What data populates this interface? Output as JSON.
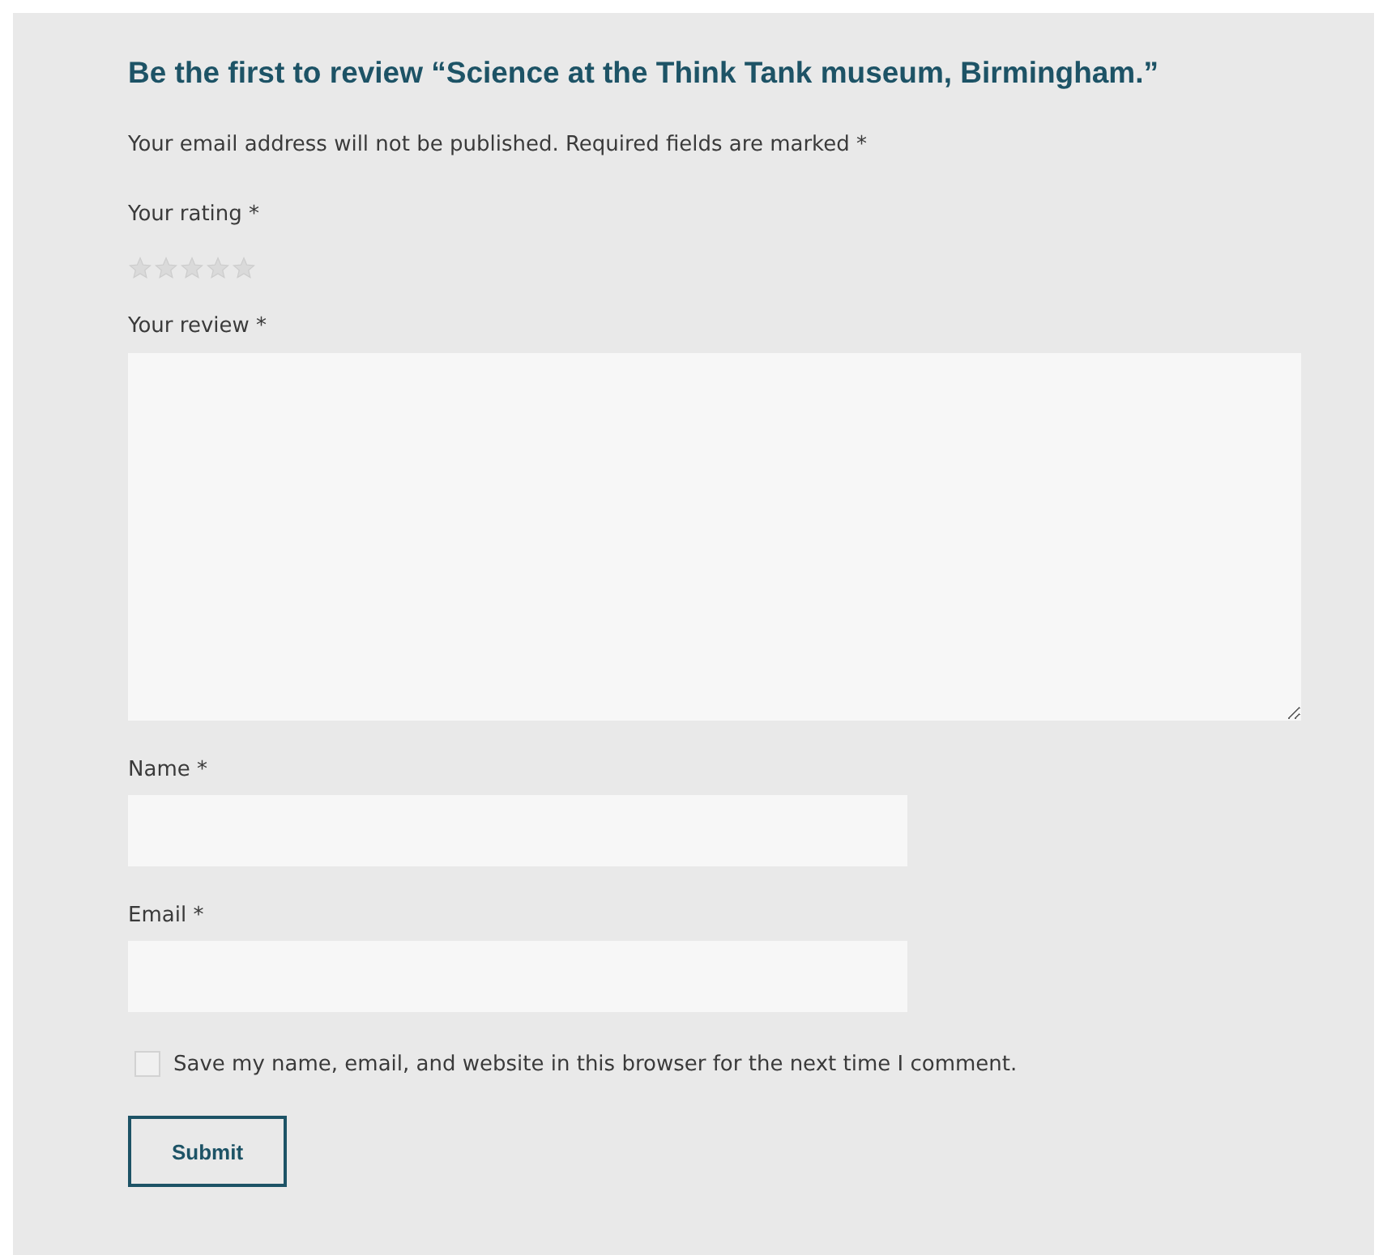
{
  "heading": "Be the first to review “Science at the Think Tank museum, Birmingham.”",
  "notice": "Your email address will not be published. Required fields are marked *",
  "rating": {
    "label": "Your rating *",
    "stars": 0
  },
  "review": {
    "label": "Your review *"
  },
  "fields": [
    {
      "label": "Name *"
    },
    {
      "label": "Email *"
    }
  ],
  "consent": {
    "label": "Save my name, email, and website in this browser for the next time I comment.",
    "checked": false
  },
  "submit": "Submit"
}
